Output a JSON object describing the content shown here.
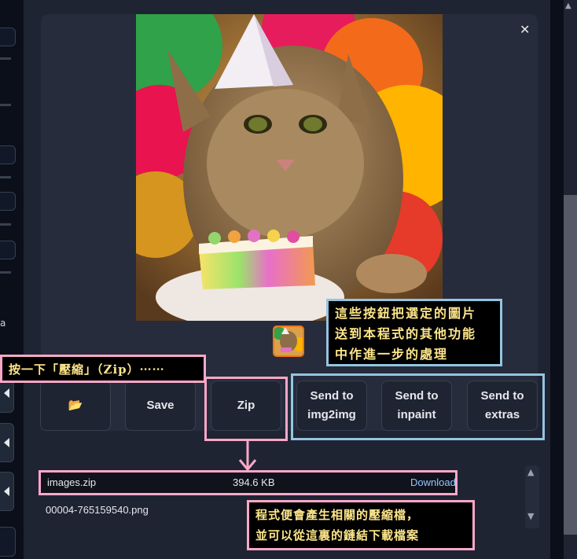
{
  "left_panel": {
    "partial_text": "a"
  },
  "gallery": {
    "close_icon": "close-icon",
    "image_subject": "tabby cat with party hat and rainbow cake"
  },
  "buttons": {
    "folder": "📂",
    "save": "Save",
    "zip": "Zip",
    "send_img2img": "Send to\nimg2img",
    "send_inpaint": "Send to\ninpaint",
    "send_extras": "Send to\nextras"
  },
  "annotations": {
    "zip_note": "按一下「壓縮」（Zip）⋯⋯",
    "send_note_1": "這些按鈕把選定的圖片",
    "send_note_2": "送到本程式的其他功能",
    "send_note_3": "中作進一步的處理",
    "result_note_1": "程式便會產生相關的壓縮檔，",
    "result_note_2": "並可以從這裏的鏈結下載檔案"
  },
  "files": [
    {
      "name": "images.zip",
      "size": "394.6 KB",
      "action": "Download"
    },
    {
      "name": "00004-765159540.png"
    }
  ],
  "colors": {
    "annotation_pink": "#f9a8c9",
    "annotation_blue": "#93c5e0",
    "link": "#93c5fd"
  }
}
